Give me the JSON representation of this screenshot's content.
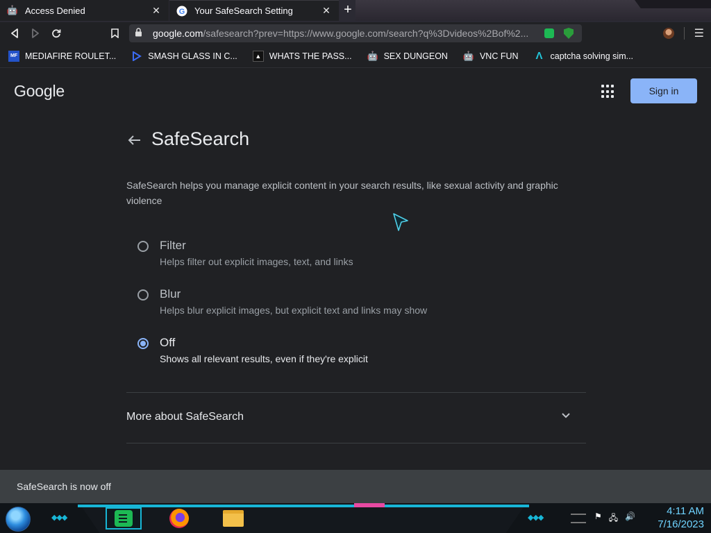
{
  "browser": {
    "tabs": [
      {
        "title": "Access Denied",
        "active": false,
        "icon": "robot-icon"
      },
      {
        "title": "Your SafeSearch Setting",
        "active": true,
        "icon": "google-g-icon"
      }
    ],
    "new_tab": "+",
    "url_host": "google.com",
    "url_path": "/safesearch?prev=https://www.google.com/search?q%3Dvideos%2Bof%2...",
    "bookmarks": [
      {
        "label": "MEDIAFIRE ROULET...",
        "icon": "mediafire-icon",
        "icon_text": "MF"
      },
      {
        "label": "SMASH GLASS IN C...",
        "icon": "play-icon"
      },
      {
        "label": "WHATS THE PASS...",
        "icon": "wp-icon",
        "icon_text": "▲"
      },
      {
        "label": "SEX DUNGEON",
        "icon": "robot-icon"
      },
      {
        "label": "VNC FUN",
        "icon": "robot-icon"
      },
      {
        "label": "captcha solving sim...",
        "icon": "captcha-icon"
      }
    ]
  },
  "page": {
    "logo": "Google",
    "sign_in": "Sign in",
    "title": "SafeSearch",
    "description": "SafeSearch helps you manage explicit content in your search results, like sexual activity and graphic violence",
    "options": [
      {
        "label": "Filter",
        "sub": "Helps filter out explicit images, text, and links",
        "checked": false
      },
      {
        "label": "Blur",
        "sub": "Helps blur explicit images, but explicit text and links may show",
        "checked": false
      },
      {
        "label": "Off",
        "sub": "Shows all relevant results, even if they're explicit",
        "checked": true
      }
    ],
    "more": "More about SafeSearch",
    "snackbar": "SafeSearch is now off",
    "accent": "#8ab4f8"
  },
  "taskbar": {
    "time": "4:11 AM",
    "date": "7/16/2023"
  }
}
